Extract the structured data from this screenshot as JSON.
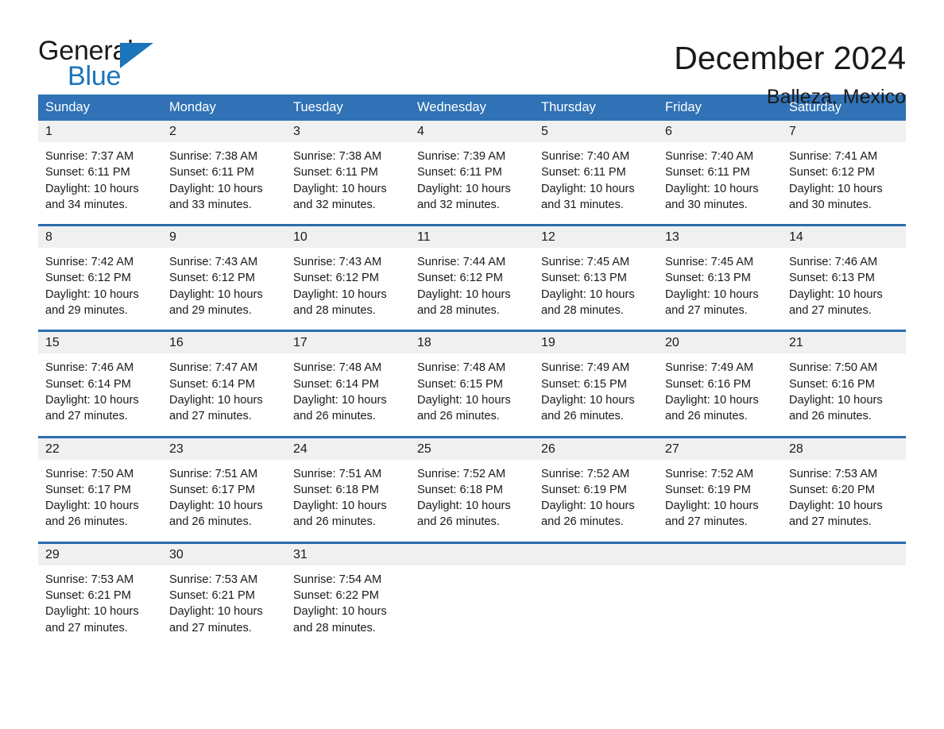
{
  "brand": {
    "name_top": "General",
    "name_bottom": "Blue",
    "accent_color": "#1b75bb",
    "triangle_icon": "triangle-icon"
  },
  "header": {
    "title": "December 2024",
    "location": "Balleza, Mexico"
  },
  "calendar": {
    "header_bg": "#3072b5",
    "row_divider_color": "#2b6cad",
    "daynum_bg": "#f0f0f0",
    "weekdays": [
      "Sunday",
      "Monday",
      "Tuesday",
      "Wednesday",
      "Thursday",
      "Friday",
      "Saturday"
    ],
    "weeks": [
      [
        {
          "day": "1",
          "sunrise": "Sunrise: 7:37 AM",
          "sunset": "Sunset: 6:11 PM",
          "daylight_line1": "Daylight: 10 hours",
          "daylight_line2": "and 34 minutes."
        },
        {
          "day": "2",
          "sunrise": "Sunrise: 7:38 AM",
          "sunset": "Sunset: 6:11 PM",
          "daylight_line1": "Daylight: 10 hours",
          "daylight_line2": "and 33 minutes."
        },
        {
          "day": "3",
          "sunrise": "Sunrise: 7:38 AM",
          "sunset": "Sunset: 6:11 PM",
          "daylight_line1": "Daylight: 10 hours",
          "daylight_line2": "and 32 minutes."
        },
        {
          "day": "4",
          "sunrise": "Sunrise: 7:39 AM",
          "sunset": "Sunset: 6:11 PM",
          "daylight_line1": "Daylight: 10 hours",
          "daylight_line2": "and 32 minutes."
        },
        {
          "day": "5",
          "sunrise": "Sunrise: 7:40 AM",
          "sunset": "Sunset: 6:11 PM",
          "daylight_line1": "Daylight: 10 hours",
          "daylight_line2": "and 31 minutes."
        },
        {
          "day": "6",
          "sunrise": "Sunrise: 7:40 AM",
          "sunset": "Sunset: 6:11 PM",
          "daylight_line1": "Daylight: 10 hours",
          "daylight_line2": "and 30 minutes."
        },
        {
          "day": "7",
          "sunrise": "Sunrise: 7:41 AM",
          "sunset": "Sunset: 6:12 PM",
          "daylight_line1": "Daylight: 10 hours",
          "daylight_line2": "and 30 minutes."
        }
      ],
      [
        {
          "day": "8",
          "sunrise": "Sunrise: 7:42 AM",
          "sunset": "Sunset: 6:12 PM",
          "daylight_line1": "Daylight: 10 hours",
          "daylight_line2": "and 29 minutes."
        },
        {
          "day": "9",
          "sunrise": "Sunrise: 7:43 AM",
          "sunset": "Sunset: 6:12 PM",
          "daylight_line1": "Daylight: 10 hours",
          "daylight_line2": "and 29 minutes."
        },
        {
          "day": "10",
          "sunrise": "Sunrise: 7:43 AM",
          "sunset": "Sunset: 6:12 PM",
          "daylight_line1": "Daylight: 10 hours",
          "daylight_line2": "and 28 minutes."
        },
        {
          "day": "11",
          "sunrise": "Sunrise: 7:44 AM",
          "sunset": "Sunset: 6:12 PM",
          "daylight_line1": "Daylight: 10 hours",
          "daylight_line2": "and 28 minutes."
        },
        {
          "day": "12",
          "sunrise": "Sunrise: 7:45 AM",
          "sunset": "Sunset: 6:13 PM",
          "daylight_line1": "Daylight: 10 hours",
          "daylight_line2": "and 28 minutes."
        },
        {
          "day": "13",
          "sunrise": "Sunrise: 7:45 AM",
          "sunset": "Sunset: 6:13 PM",
          "daylight_line1": "Daylight: 10 hours",
          "daylight_line2": "and 27 minutes."
        },
        {
          "day": "14",
          "sunrise": "Sunrise: 7:46 AM",
          "sunset": "Sunset: 6:13 PM",
          "daylight_line1": "Daylight: 10 hours",
          "daylight_line2": "and 27 minutes."
        }
      ],
      [
        {
          "day": "15",
          "sunrise": "Sunrise: 7:46 AM",
          "sunset": "Sunset: 6:14 PM",
          "daylight_line1": "Daylight: 10 hours",
          "daylight_line2": "and 27 minutes."
        },
        {
          "day": "16",
          "sunrise": "Sunrise: 7:47 AM",
          "sunset": "Sunset: 6:14 PM",
          "daylight_line1": "Daylight: 10 hours",
          "daylight_line2": "and 27 minutes."
        },
        {
          "day": "17",
          "sunrise": "Sunrise: 7:48 AM",
          "sunset": "Sunset: 6:14 PM",
          "daylight_line1": "Daylight: 10 hours",
          "daylight_line2": "and 26 minutes."
        },
        {
          "day": "18",
          "sunrise": "Sunrise: 7:48 AM",
          "sunset": "Sunset: 6:15 PM",
          "daylight_line1": "Daylight: 10 hours",
          "daylight_line2": "and 26 minutes."
        },
        {
          "day": "19",
          "sunrise": "Sunrise: 7:49 AM",
          "sunset": "Sunset: 6:15 PM",
          "daylight_line1": "Daylight: 10 hours",
          "daylight_line2": "and 26 minutes."
        },
        {
          "day": "20",
          "sunrise": "Sunrise: 7:49 AM",
          "sunset": "Sunset: 6:16 PM",
          "daylight_line1": "Daylight: 10 hours",
          "daylight_line2": "and 26 minutes."
        },
        {
          "day": "21",
          "sunrise": "Sunrise: 7:50 AM",
          "sunset": "Sunset: 6:16 PM",
          "daylight_line1": "Daylight: 10 hours",
          "daylight_line2": "and 26 minutes."
        }
      ],
      [
        {
          "day": "22",
          "sunrise": "Sunrise: 7:50 AM",
          "sunset": "Sunset: 6:17 PM",
          "daylight_line1": "Daylight: 10 hours",
          "daylight_line2": "and 26 minutes."
        },
        {
          "day": "23",
          "sunrise": "Sunrise: 7:51 AM",
          "sunset": "Sunset: 6:17 PM",
          "daylight_line1": "Daylight: 10 hours",
          "daylight_line2": "and 26 minutes."
        },
        {
          "day": "24",
          "sunrise": "Sunrise: 7:51 AM",
          "sunset": "Sunset: 6:18 PM",
          "daylight_line1": "Daylight: 10 hours",
          "daylight_line2": "and 26 minutes."
        },
        {
          "day": "25",
          "sunrise": "Sunrise: 7:52 AM",
          "sunset": "Sunset: 6:18 PM",
          "daylight_line1": "Daylight: 10 hours",
          "daylight_line2": "and 26 minutes."
        },
        {
          "day": "26",
          "sunrise": "Sunrise: 7:52 AM",
          "sunset": "Sunset: 6:19 PM",
          "daylight_line1": "Daylight: 10 hours",
          "daylight_line2": "and 26 minutes."
        },
        {
          "day": "27",
          "sunrise": "Sunrise: 7:52 AM",
          "sunset": "Sunset: 6:19 PM",
          "daylight_line1": "Daylight: 10 hours",
          "daylight_line2": "and 27 minutes."
        },
        {
          "day": "28",
          "sunrise": "Sunrise: 7:53 AM",
          "sunset": "Sunset: 6:20 PM",
          "daylight_line1": "Daylight: 10 hours",
          "daylight_line2": "and 27 minutes."
        }
      ],
      [
        {
          "day": "29",
          "sunrise": "Sunrise: 7:53 AM",
          "sunset": "Sunset: 6:21 PM",
          "daylight_line1": "Daylight: 10 hours",
          "daylight_line2": "and 27 minutes."
        },
        {
          "day": "30",
          "sunrise": "Sunrise: 7:53 AM",
          "sunset": "Sunset: 6:21 PM",
          "daylight_line1": "Daylight: 10 hours",
          "daylight_line2": "and 27 minutes."
        },
        {
          "day": "31",
          "sunrise": "Sunrise: 7:54 AM",
          "sunset": "Sunset: 6:22 PM",
          "daylight_line1": "Daylight: 10 hours",
          "daylight_line2": "and 28 minutes."
        },
        {
          "day": "",
          "sunrise": "",
          "sunset": "",
          "daylight_line1": "",
          "daylight_line2": ""
        },
        {
          "day": "",
          "sunrise": "",
          "sunset": "",
          "daylight_line1": "",
          "daylight_line2": ""
        },
        {
          "day": "",
          "sunrise": "",
          "sunset": "",
          "daylight_line1": "",
          "daylight_line2": ""
        },
        {
          "day": "",
          "sunrise": "",
          "sunset": "",
          "daylight_line1": "",
          "daylight_line2": ""
        }
      ]
    ]
  }
}
